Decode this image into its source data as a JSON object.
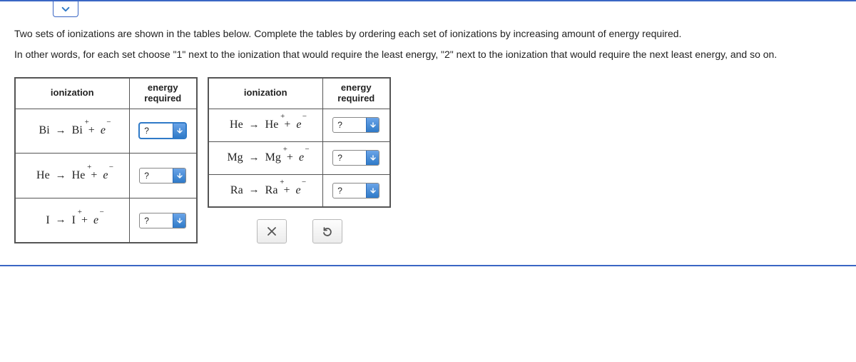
{
  "instructions": {
    "line1": "Two sets of ionizations are shown in the tables below. Complete the tables by ordering each set of ionizations by increasing amount of energy required.",
    "line2": "In other words, for each set choose \"1\" next to the ionization that would require the least energy, \"2\" next to the ionization that would require the next least energy, and so on."
  },
  "headers": {
    "ionization": "ionization",
    "energy": "energy\nrequired"
  },
  "dropdown_placeholder": "?",
  "table1": {
    "rows": [
      {
        "lhs": "Bi",
        "rhs": "Bi",
        "value": "?",
        "focused": true
      },
      {
        "lhs": "He",
        "rhs": "He",
        "value": "?",
        "focused": false
      },
      {
        "lhs": "I",
        "rhs": "I",
        "value": "?",
        "focused": false
      }
    ]
  },
  "table2": {
    "rows": [
      {
        "lhs": "He",
        "rhs": "He",
        "value": "?",
        "focused": false
      },
      {
        "lhs": "Mg",
        "rhs": "Mg",
        "value": "?",
        "focused": false
      },
      {
        "lhs": "Ra",
        "rhs": "Ra",
        "value": "?",
        "focused": false
      }
    ]
  },
  "icons": {
    "collapse": "chevron-down",
    "clear": "x",
    "reset": "undo"
  }
}
